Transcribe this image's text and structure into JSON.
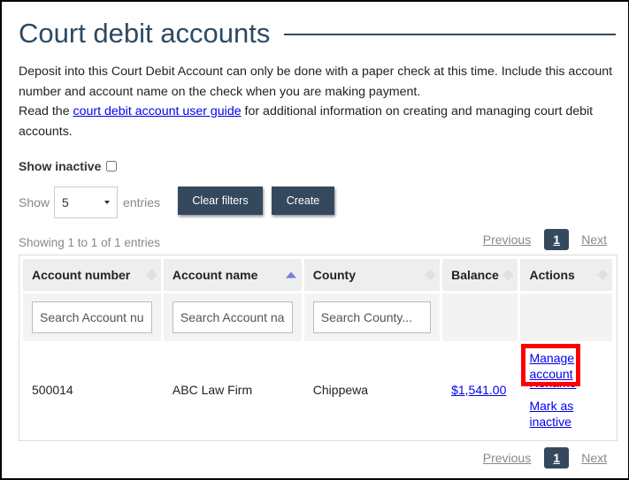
{
  "page": {
    "title": "Court debit accounts",
    "intro_line1": "Deposit into this Court Debit Account can only be done with a paper check at this time. Include this account number and account name on the check when you are making payment.",
    "intro_line2_prefix": "Read the ",
    "intro_link": "court debit account user guide",
    "intro_line2_suffix": " for additional information on creating and managing court debit accounts."
  },
  "filters": {
    "show_inactive_label": "Show inactive",
    "show_inactive_checked": false,
    "show_label": "Show",
    "entries_label": "entries",
    "page_length": "5",
    "clear_filters_label": "Clear filters",
    "create_label": "Create"
  },
  "table_info": "Showing 1 to 1 of 1 entries",
  "pagination": {
    "previous": "Previous",
    "current_page": "1",
    "next": "Next"
  },
  "table": {
    "columns": [
      {
        "label": "Account number",
        "sort": "none",
        "search_placeholder": "Search Account number..."
      },
      {
        "label": "Account name",
        "sort": "ascending",
        "search_placeholder": "Search Account name..."
      },
      {
        "label": "County",
        "sort": "none",
        "search_placeholder": "Search County..."
      },
      {
        "label": "Balance",
        "sort": "none"
      },
      {
        "label": "Actions",
        "sort": "none"
      }
    ],
    "rows": [
      {
        "account_number": "500014",
        "account_name": "ABC Law Firm",
        "county": "Chippewa",
        "balance": "$1,541.00",
        "actions": [
          "Manage account",
          "Rename",
          "Mark as inactive"
        ]
      }
    ]
  },
  "highlight": {
    "target": "Manage account",
    "color": "#ff0000"
  }
}
